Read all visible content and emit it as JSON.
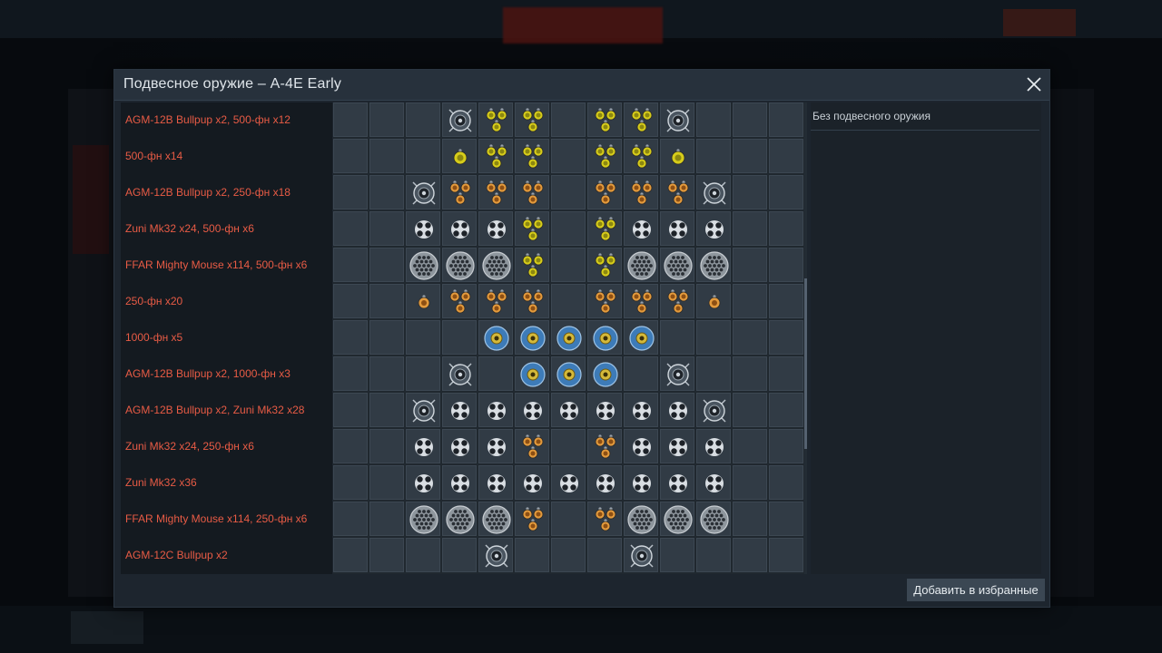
{
  "dialog": {
    "title": "Подвесное оружие – A-4E Early",
    "add_favorite_label": "Добавить в избранные",
    "info_text": "Без подвесного оружия"
  },
  "colors": {
    "preset_text": "#e85b45",
    "dialog_bg": "#1d252e",
    "cell_bg": "#313b45"
  },
  "presets": [
    "AGM-12B Bullpup x2,  500-фн x12",
    "500-фн x14",
    "AGM-12B Bullpup x2,  250-фн x18",
    "Zuni Mk32 x24,  500-фн x6",
    "FFAR Mighty Mouse x114,  500-фн x6",
    "250-фн x20",
    "1000-фн x5",
    "AGM-12B Bullpup x2,  1000-фн x3",
    "AGM-12B Bullpup x2,  Zuni Mk32 x28",
    "Zuni Mk32 x24,  250-фн x6",
    "Zuni Mk32 x36",
    "FFAR Mighty Mouse x114,  250-фн x6",
    "AGM-12C Bullpup x2"
  ],
  "icon_legend": {
    "A": "agm-bullpup-icon",
    "Y": "bomb-500lb-cluster-icon",
    "y": "bomb-500lb-single-icon",
    "O": "bomb-250lb-cluster-icon",
    "o": "bomb-250lb-single-icon",
    "Z": "zuni-rocket-pod-icon",
    "F": "ffar-rocket-pod-icon",
    "B": "bomb-1000lb-icon",
    "C": "agm-12c-icon",
    ".": "empty-slot"
  },
  "grid": [
    "...AYY.YYA...",
    "...yYY.YYy...",
    "..AOOO.OOOA..",
    "..ZZZY.YZZZ..",
    "..FFFY.YFFF..",
    "..oOOO.OOOo..",
    "....BBBBB....",
    "...A.BBB.A...",
    "..AZZZZZZZA..",
    "..ZZZO.OZZZ..",
    "..ZZZZZZZZZ..",
    "..FFFO.OFFF..",
    "....C...C...."
  ]
}
